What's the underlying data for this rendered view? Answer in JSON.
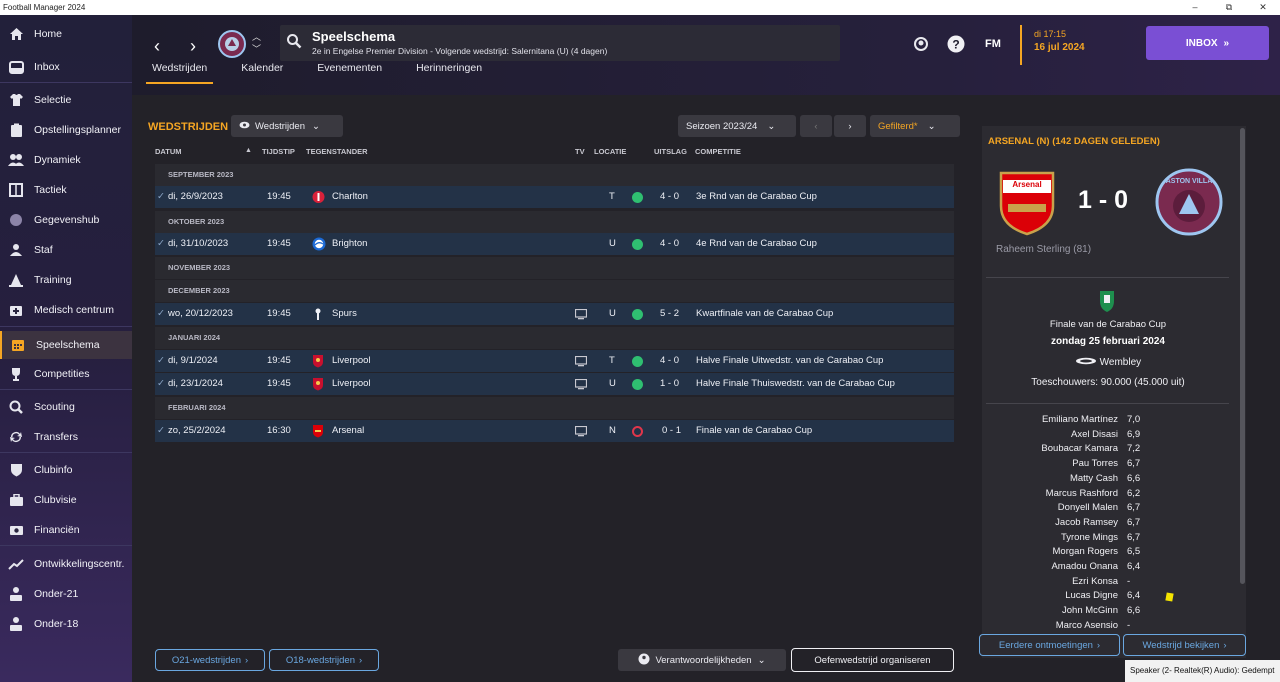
{
  "window": {
    "title": "Football Manager 2024",
    "minimize": "–",
    "maximize": "⧉",
    "close": "✕"
  },
  "sidebar": {
    "items": [
      {
        "label": "Home"
      },
      {
        "label": "Inbox"
      },
      {
        "label": "Selectie"
      },
      {
        "label": "Opstellingsplanner"
      },
      {
        "label": "Dynamiek"
      },
      {
        "label": "Tactiek"
      },
      {
        "label": "Gegevenshub"
      },
      {
        "label": "Staf"
      },
      {
        "label": "Training"
      },
      {
        "label": "Medisch centrum"
      },
      {
        "label": "Speelschema"
      },
      {
        "label": "Competities"
      },
      {
        "label": "Scouting"
      },
      {
        "label": "Transfers"
      },
      {
        "label": "Clubinfo"
      },
      {
        "label": "Clubvisie"
      },
      {
        "label": "Financiën"
      },
      {
        "label": "Ontwikkelingscentr."
      },
      {
        "label": "Onder-21"
      },
      {
        "label": "Onder-18"
      }
    ],
    "active": "Speelschema"
  },
  "header": {
    "title": "Speelschema",
    "subtitle": "2e in Engelse Premier Division - Volgende wedstrijd: Salernitana (U) (4 dagen)",
    "fm_label": "FM",
    "date_time": "di 17:15",
    "date": "16 jul 2024",
    "inbox_label": "INBOX",
    "inbox_icon": "»"
  },
  "tabs": [
    {
      "label": "Wedstrijden"
    },
    {
      "label": "Kalender"
    },
    {
      "label": "Evenementen"
    },
    {
      "label": "Herinneringen"
    }
  ],
  "fixtures": {
    "section_title": "WEDSTRIJDEN",
    "view_dropdown": "Wedstrijden",
    "season_dropdown": "Seizoen 2023/24",
    "filter_label": "Gefilterd*",
    "columns": {
      "date": "DATUM",
      "time": "TIJDSTIP",
      "opponent": "TEGENSTANDER",
      "tv": "TV",
      "location": "LOCATIE",
      "result": "UITSLAG",
      "competition": "COMPETITIE"
    },
    "months": [
      "SEPTEMBER 2023",
      "OKTOBER 2023",
      "NOVEMBER 2023",
      "DECEMBER 2023",
      "JANUARI 2024",
      "FEBRUARI 2024"
    ],
    "matches": [
      {
        "date": "di, 26/9/2023",
        "time": "19:45",
        "opponent": "Charlton",
        "tv": false,
        "loc": "T",
        "result": "4 - 0",
        "outcome": "win",
        "competition": "3e Rnd van de Carabao Cup"
      },
      {
        "date": "di, 31/10/2023",
        "time": "19:45",
        "opponent": "Brighton",
        "tv": false,
        "loc": "U",
        "result": "4 - 0",
        "outcome": "win",
        "competition": "4e Rnd van de Carabao Cup"
      },
      {
        "date": "wo, 20/12/2023",
        "time": "19:45",
        "opponent": "Spurs",
        "tv": true,
        "loc": "U",
        "result": "5 - 2",
        "outcome": "win",
        "competition": "Kwartfinale van de Carabao Cup"
      },
      {
        "date": "di, 9/1/2024",
        "time": "19:45",
        "opponent": "Liverpool",
        "tv": true,
        "loc": "T",
        "result": "4 - 0",
        "outcome": "win",
        "competition": "Halve Finale Uitwedstr. van de Carabao Cup"
      },
      {
        "date": "di, 23/1/2024",
        "time": "19:45",
        "opponent": "Liverpool",
        "tv": true,
        "loc": "U",
        "result": "1 - 0",
        "outcome": "win",
        "competition": "Halve Finale Thuiswedstr. van de Carabao Cup"
      },
      {
        "date": "zo, 25/2/2024",
        "time": "16:30",
        "opponent": "Arsenal",
        "tv": true,
        "loc": "N",
        "result": "0 - 1",
        "outcome": "loss",
        "competition": "Finale van de Carabao Cup"
      }
    ],
    "buttons": {
      "u21": "O21-wedstrijden",
      "u18": "O18-wedstrijden",
      "responsibilities": "Verantwoordelijkheden",
      "friendly": "Oefenwedstrijd organiseren"
    }
  },
  "match_panel": {
    "title": "ARSENAL (N) (142 DAGEN GELEDEN)",
    "home_badge_text": "Arsenal",
    "away_badge_text": "ASTON VILLA",
    "score": "1 - 0",
    "scorer": "Raheem Sterling (81)",
    "competition": "Finale van de Carabao Cup",
    "date": "zondag 25 februari 2024",
    "venue": "Wembley",
    "attendance": "Toeschouwers: 90.000 (45.000 uit)",
    "players": [
      {
        "name": "Emiliano Martínez",
        "rating": "7,0"
      },
      {
        "name": "Axel Disasi",
        "rating": "6,9"
      },
      {
        "name": "Boubacar Kamara",
        "rating": "7,2"
      },
      {
        "name": "Pau Torres",
        "rating": "6,7"
      },
      {
        "name": "Matty Cash",
        "rating": "6,6"
      },
      {
        "name": "Marcus Rashford",
        "rating": "6,2"
      },
      {
        "name": "Donyell Malen",
        "rating": "6,7"
      },
      {
        "name": "Jacob Ramsey",
        "rating": "6,7"
      },
      {
        "name": "Tyrone Mings",
        "rating": "6,7"
      },
      {
        "name": "Morgan Rogers",
        "rating": "6,5"
      },
      {
        "name": "Amadou Onana",
        "rating": "6,4"
      },
      {
        "name": "Ezri Konsa",
        "rating": "-"
      },
      {
        "name": "Lucas Digne",
        "rating": "6,4",
        "yellow_card": true
      },
      {
        "name": "John McGinn",
        "rating": "6,6"
      },
      {
        "name": "Marco Asensio",
        "rating": "-"
      }
    ],
    "buttons": {
      "previous": "Eerdere ontmoetingen",
      "view": "Wedstrijd bekijken"
    }
  },
  "status": {
    "speaker": "Speaker (2- Realtek(R) Audio): Gedempt"
  },
  "colors": {
    "accent": "#f5a623",
    "win": "#2fbf71",
    "loss": "#e0364b",
    "row": "#233247",
    "inbox": "#7a4fd4"
  }
}
